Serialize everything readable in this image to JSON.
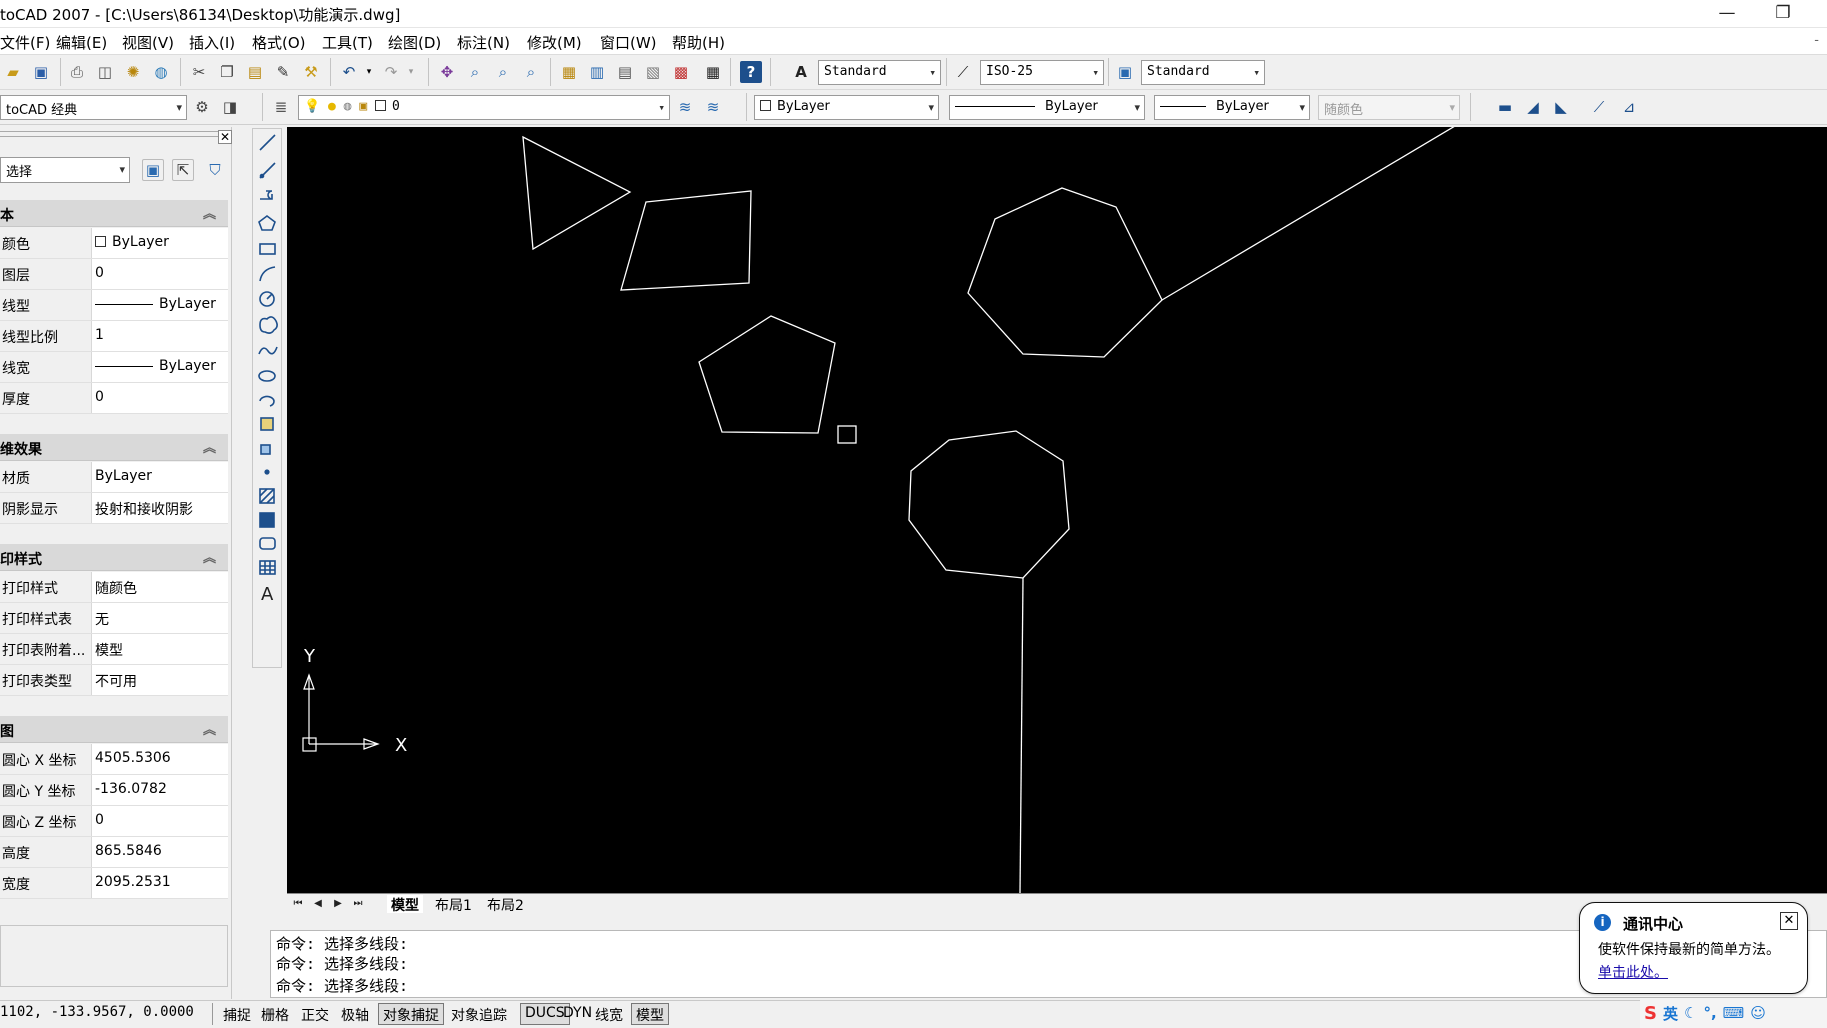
{
  "window": {
    "title": "toCAD 2007 - [C:\\Users\\86134\\Desktop\\功能演示.dwg]",
    "minimize": "—",
    "restore": "❐"
  },
  "menu": [
    "文件(F)",
    "编辑(E)",
    "视图(V)",
    "插入(I)",
    "格式(O)",
    "工具(T)",
    "绘图(D)",
    "标注(N)",
    "修改(M)",
    "窗口(W)",
    "帮助(H)"
  ],
  "mdi_close": "-",
  "toolbar1": {
    "text_style": "Standard",
    "dim_style": "ISO-25",
    "table_style": "Standard"
  },
  "toolbar2": {
    "workspace": "toCAD 经典",
    "layer": "0",
    "color": "ByLayer",
    "linetype": "ByLayer",
    "lineweight": "ByLayer",
    "plotstyle": "随颜色"
  },
  "palette": {
    "select": "选择",
    "sections": [
      {
        "title": "本",
        "rows": [
          {
            "label": "颜色",
            "value": "ByLayer",
            "kind": "color"
          },
          {
            "label": "图层",
            "value": "0"
          },
          {
            "label": "线型",
            "value": "ByLayer",
            "kind": "line"
          },
          {
            "label": "线型比例",
            "value": "1"
          },
          {
            "label": "线宽",
            "value": "ByLayer",
            "kind": "line"
          },
          {
            "label": "厚度",
            "value": "0"
          }
        ]
      },
      {
        "title": "维效果",
        "rows": [
          {
            "label": "材质",
            "value": "ByLayer"
          },
          {
            "label": "阴影显示",
            "value": "投射和接收阴影"
          }
        ]
      },
      {
        "title": "印样式",
        "rows": [
          {
            "label": "打印样式",
            "value": "随颜色"
          },
          {
            "label": "打印样式表",
            "value": "无"
          },
          {
            "label": "打印表附着...",
            "value": "模型"
          },
          {
            "label": "打印表类型",
            "value": "不可用"
          }
        ]
      },
      {
        "title": "图",
        "rows": [
          {
            "label": "圆心 X 坐标",
            "value": "4505.5306"
          },
          {
            "label": "圆心 Y 坐标",
            "value": "-136.0782"
          },
          {
            "label": "圆心 Z 坐标",
            "value": "0"
          },
          {
            "label": "高度",
            "value": "865.5846"
          },
          {
            "label": "宽度",
            "value": "2095.2531"
          }
        ]
      }
    ]
  },
  "canvas": {
    "ucs_x": "X",
    "ucs_y": "Y"
  },
  "layout_tabs": [
    "模型",
    "布局1",
    "布局2"
  ],
  "command_lines": [
    "命令: 选择多线段:",
    "命令: 选择多线段:",
    "命令: 选择多线段:"
  ],
  "status": {
    "coords": "1102, -133.9567, 0.0000",
    "buttons": [
      {
        "label": "捕捉",
        "on": false
      },
      {
        "label": "栅格",
        "on": false
      },
      {
        "label": "正交",
        "on": false
      },
      {
        "label": "极轴",
        "on": false
      },
      {
        "label": "对象捕捉",
        "on": true
      },
      {
        "label": "对象追踪",
        "on": false
      },
      {
        "label": "DUCS",
        "on": true
      },
      {
        "label": "DYN",
        "on": false
      },
      {
        "label": "线宽",
        "on": false
      },
      {
        "label": "模型",
        "on": true
      }
    ]
  },
  "comm_center": {
    "title": "通讯中心",
    "message": "使软件保持最新的简单方法。",
    "link": "单击此处。"
  },
  "tray": {
    "ime": "英"
  },
  "colors": {
    "canvas_bg": "#000000",
    "geometry_stroke": "#ffffff",
    "link": "#1a0dab",
    "info_icon": "#1565c0"
  }
}
